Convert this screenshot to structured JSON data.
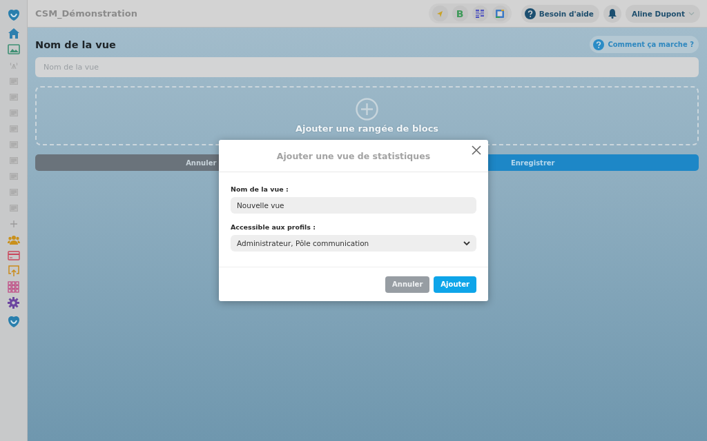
{
  "sidebar": {
    "items": [
      {
        "kind": "logo"
      },
      {
        "kind": "home"
      },
      {
        "kind": "image"
      },
      {
        "kind": "antenna"
      },
      {
        "kind": "doc"
      },
      {
        "kind": "doc"
      },
      {
        "kind": "doc"
      },
      {
        "kind": "doc"
      },
      {
        "kind": "doc"
      },
      {
        "kind": "doc"
      },
      {
        "kind": "doc"
      },
      {
        "kind": "doc"
      },
      {
        "kind": "doc"
      },
      {
        "kind": "plus"
      },
      {
        "kind": "people"
      },
      {
        "kind": "card"
      },
      {
        "kind": "upload"
      },
      {
        "kind": "grid"
      },
      {
        "kind": "gear"
      },
      {
        "kind": "logo"
      }
    ]
  },
  "topbar": {
    "title": "CSM_Démonstration",
    "apps": [
      {
        "kind": "arrow"
      },
      {
        "kind": "letter",
        "text": "B"
      },
      {
        "kind": "qr"
      },
      {
        "kind": "calendar"
      }
    ],
    "help": "Besoin d'aide",
    "user": "Aline Dupont"
  },
  "page": {
    "heading": "Nom de la vue",
    "how_it_works": "Comment ça marche ?",
    "name_field": {
      "placeholder": "Nom de la vue"
    },
    "add_row": "Ajouter une rangée de blocs",
    "buttons": [
      {
        "kind": "cancel",
        "label": "Annuler"
      },
      {
        "kind": "save",
        "label": "Enregistrer"
      }
    ]
  },
  "modal": {
    "title": "Ajouter une vue de statistiques",
    "fields": [
      {
        "kind": "text",
        "label": "Nom de la vue :",
        "value": "Nouvelle vue"
      },
      {
        "kind": "select",
        "label": "Accessible aux profils :",
        "value": "Administrateur, Pôle communication"
      }
    ],
    "buttons": [
      {
        "kind": "cancel",
        "label": "Annuler"
      },
      {
        "kind": "primary",
        "label": "Ajouter"
      }
    ]
  }
}
